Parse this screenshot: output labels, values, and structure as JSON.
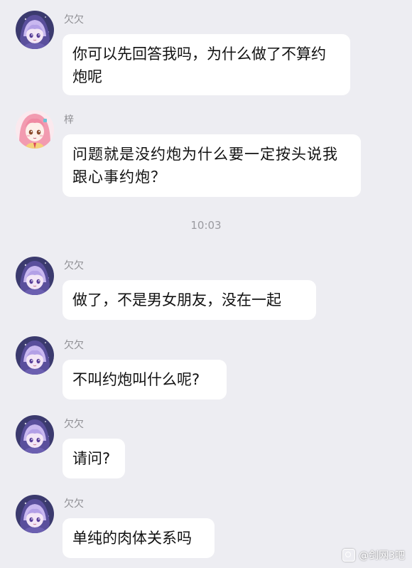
{
  "messages": [
    {
      "sender": "欠欠",
      "text": "你可以先回答我吗，为什么做了不算约炮呢"
    },
    {
      "sender": "梓",
      "text": "问题就是没约炮为什么要一定按头说我跟心事约炮？"
    },
    {
      "sender": "欠欠",
      "text": "做了，不是男女朋友，没在一起"
    },
    {
      "sender": "欠欠",
      "text": "不叫约炮叫什么呢?"
    },
    {
      "sender": "欠欠",
      "text": "请问?"
    },
    {
      "sender": "欠欠",
      "text": "单纯的肉体关系吗"
    }
  ],
  "timestamp": "10:03",
  "watermark": {
    "text": "@剑网3吧",
    "icon": "camera-icon"
  },
  "colors": {
    "background": "#ededf2",
    "bubble": "#ffffff",
    "sender_name": "#8e8e93"
  },
  "avatars": {
    "qianqian": "purple-hooded-girl-avatar",
    "zi": "pink-hair-girl-avatar"
  }
}
